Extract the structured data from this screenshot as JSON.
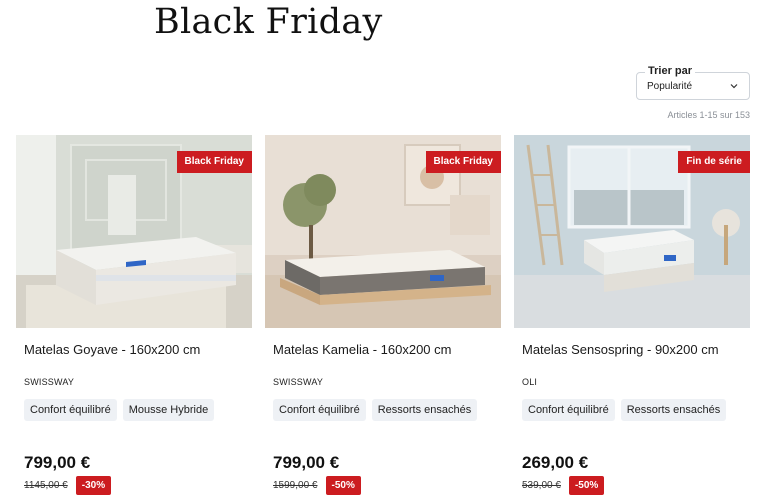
{
  "page": {
    "title": "Black Friday"
  },
  "sort": {
    "label": "Trier par",
    "value": "Popularité",
    "count_text": "Articles 1-15 sur 153"
  },
  "products": [
    {
      "badge": "Black Friday",
      "name": "Matelas Goyave - 160x200 cm",
      "brand": "SWISSWAY",
      "tags": [
        "Confort équilibré",
        "Mousse Hybride"
      ],
      "price": "799,00 €",
      "old_price": "1145,00 €",
      "discount": "-30%"
    },
    {
      "badge": "Black Friday",
      "name": "Matelas Kamelia - 160x200 cm",
      "brand": "SWISSWAY",
      "tags": [
        "Confort équilibré",
        "Ressorts ensachés"
      ],
      "price": "799,00 €",
      "old_price": "1599,00 €",
      "discount": "-50%"
    },
    {
      "badge": "Fin de série",
      "name": "Matelas Sensospring - 90x200 cm",
      "brand": "OLI",
      "tags": [
        "Confort équilibré",
        "Ressorts ensachés"
      ],
      "price": "269,00 €",
      "old_price": "539,00 €",
      "discount": "-50%"
    }
  ],
  "colors": {
    "accent_red": "#cc1c20",
    "tag_bg": "#eef1f5"
  },
  "icons": {
    "sort_chevron": "chevron-down-icon"
  }
}
